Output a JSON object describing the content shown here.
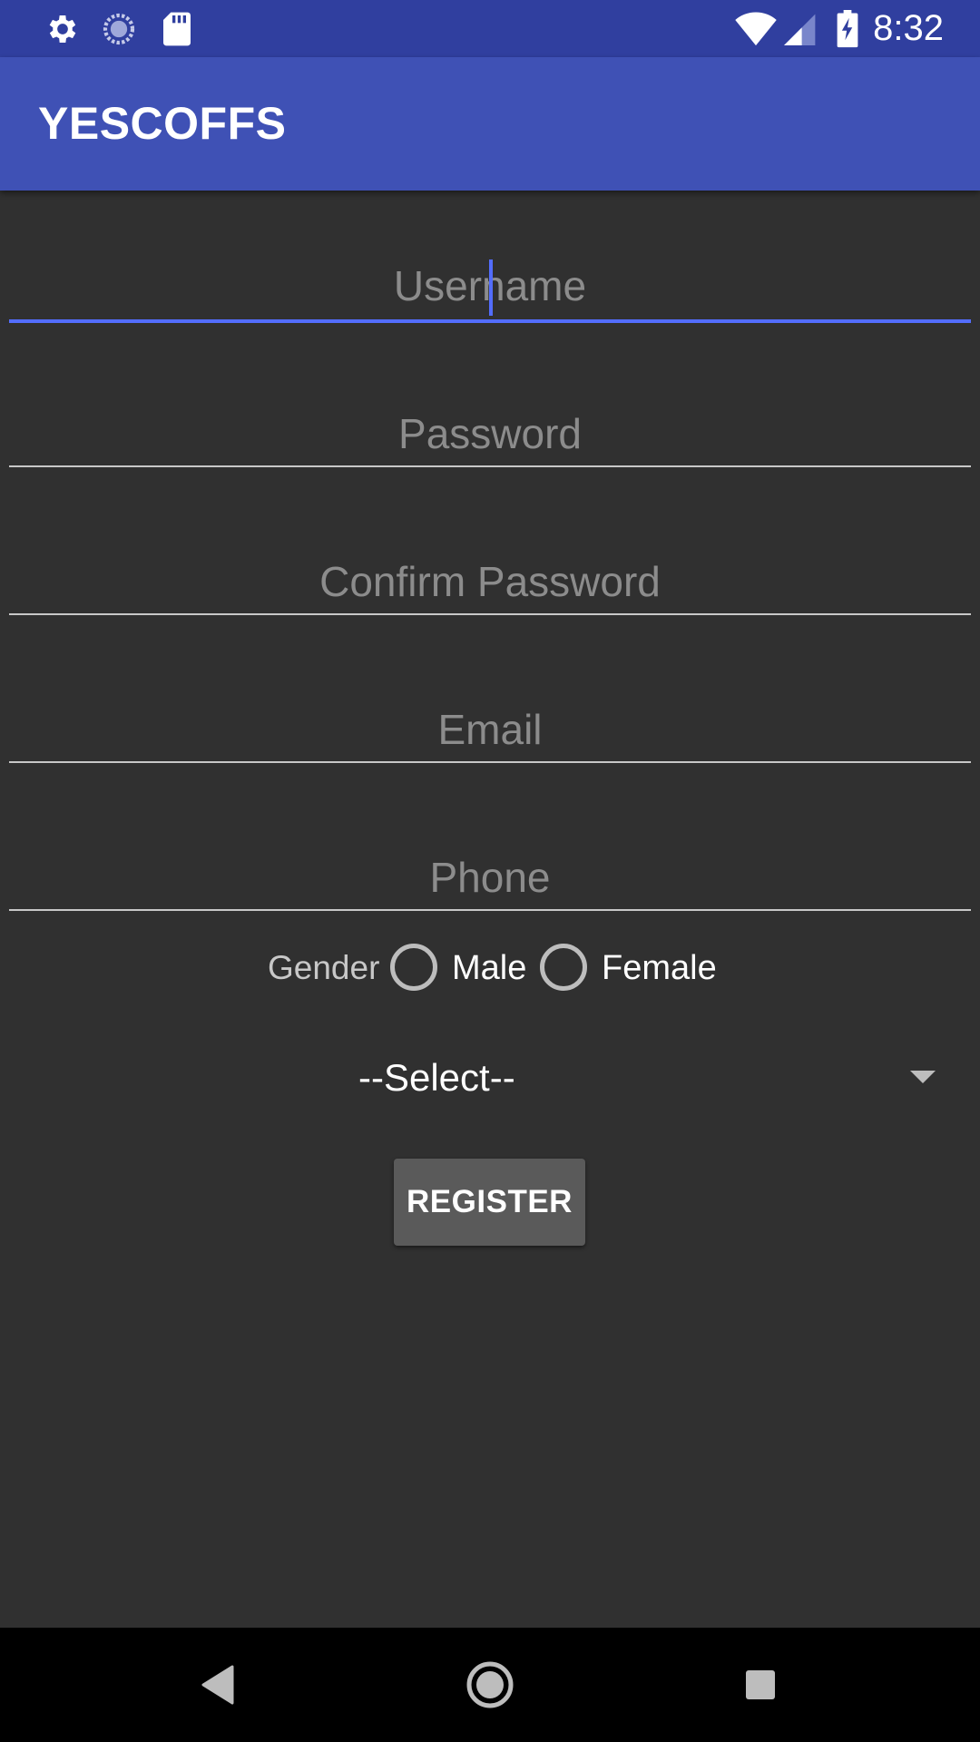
{
  "status_bar": {
    "time": "8:32",
    "left_icons": [
      "gear-icon",
      "sync-icon",
      "sd-card-icon"
    ],
    "right_icons": [
      "wifi-icon",
      "signal-icon",
      "battery-charging-icon"
    ],
    "background": "#303F9F"
  },
  "app_bar": {
    "title": "YESCOFFS",
    "background": "#3F51B5"
  },
  "form": {
    "username": {
      "placeholder": "Username",
      "focused": true
    },
    "password": {
      "placeholder": "Password"
    },
    "confirm_password": {
      "placeholder": "Confirm Password"
    },
    "email": {
      "placeholder": "Email"
    },
    "phone": {
      "placeholder": "Phone"
    },
    "gender": {
      "label": "Gender",
      "options": [
        "Male",
        "Female"
      ]
    },
    "select": {
      "value": "--Select--"
    },
    "register_label": "REGISTER"
  },
  "nav_bar": {
    "buttons": [
      "back-icon",
      "home-icon",
      "recents-icon"
    ]
  },
  "colors": {
    "accent": "#536DFE",
    "background": "#303030"
  }
}
